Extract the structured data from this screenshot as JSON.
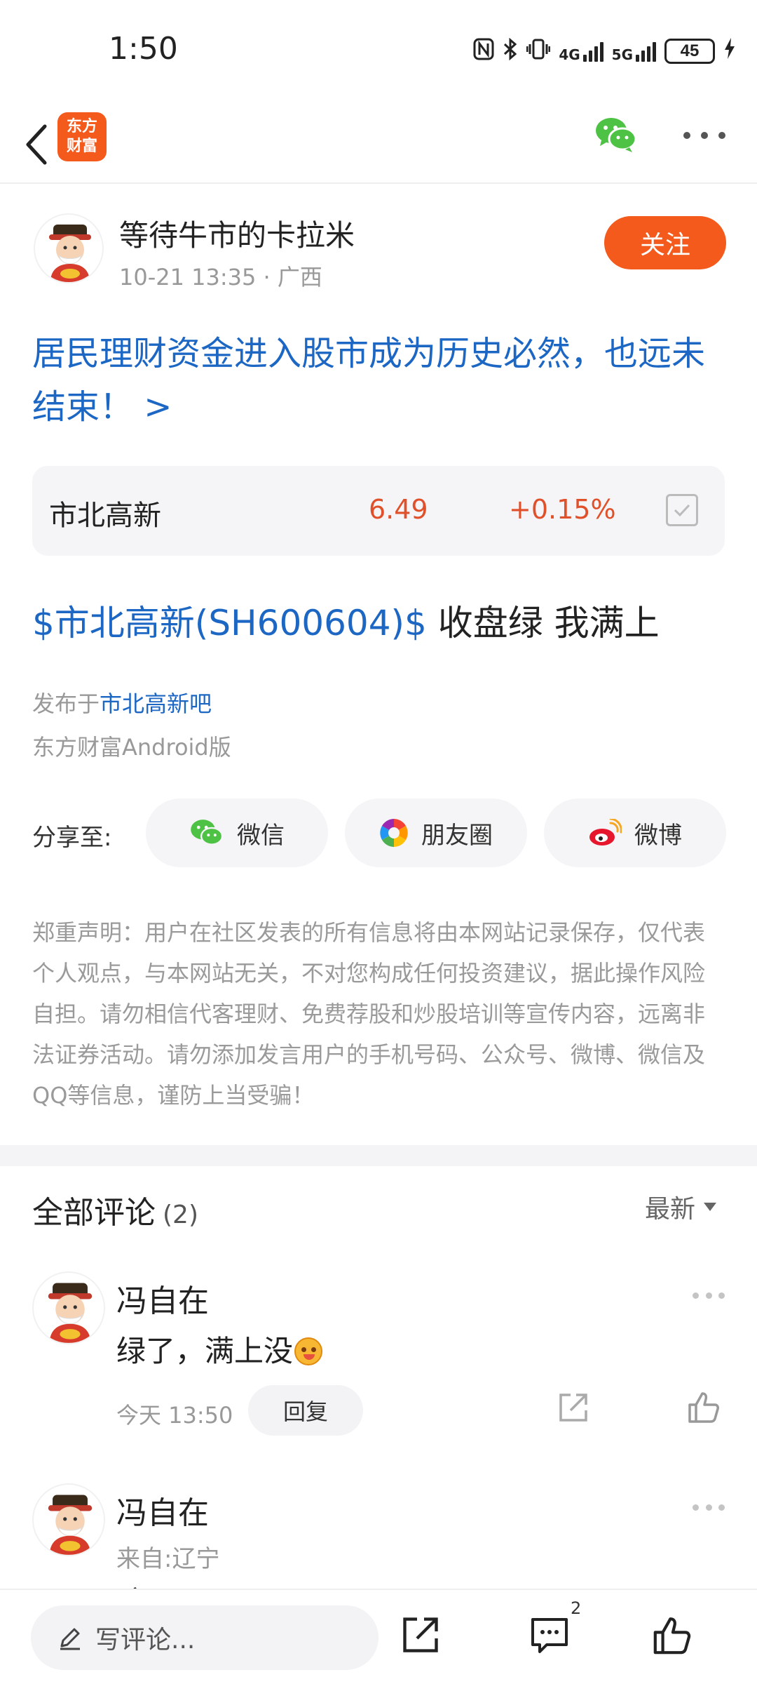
{
  "status_bar": {
    "time": "1:50",
    "network_a": "4G",
    "network_b": "5G",
    "battery": "45"
  },
  "nav": {
    "logo_line1": "东方",
    "logo_line2": "财富"
  },
  "author": {
    "name": "等待牛市的卡拉米",
    "meta": "10-21 13:35 · 广西",
    "follow_label": "关注"
  },
  "post": {
    "title": "居民理财资金进入股市成为历史必然，也远未结束！ >",
    "stock": {
      "name": "市北高新",
      "price": "6.49",
      "change": "+0.15%"
    },
    "body_link": "$市北高新(SH600604)$",
    "body_text": " 收盘绿 我满上",
    "published_prefix": "发布于",
    "published_bar": "市北高新吧",
    "client": "东方财富Android版"
  },
  "share": {
    "label": "分享至:",
    "wechat": "微信",
    "moments": "朋友圈",
    "weibo": "微博"
  },
  "disclaimer": "郑重声明：用户在社区发表的所有信息将由本网站记录保存，仅代表个人观点，与本网站无关，不对您构成任何投资建议，据此操作风险自担。请勿相信代客理财、免费荐股和炒股培训等宣传内容，远离非法证券活动。请勿添加发言用户的手机号码、公众号、微博、微信及QQ等信息，谨防上当受骗！",
  "comments": {
    "title": "全部评论",
    "count": "(2)",
    "sort": "最新",
    "items": [
      {
        "name": "冯自在",
        "text": "绿了，满上没",
        "time": "今天 13:50",
        "reply": "回复"
      },
      {
        "name": "冯自在",
        "from": "来自:辽宁",
        "text": "瞎"
      }
    ]
  },
  "bottom_bar": {
    "placeholder": "写评论...",
    "comment_badge": "2"
  },
  "colors": {
    "brand_orange": "#f35a1c",
    "link_blue": "#1d67c4",
    "price_red": "#e0502a",
    "wechat_green": "#4ec244",
    "weibo_red": "#e6162d"
  }
}
